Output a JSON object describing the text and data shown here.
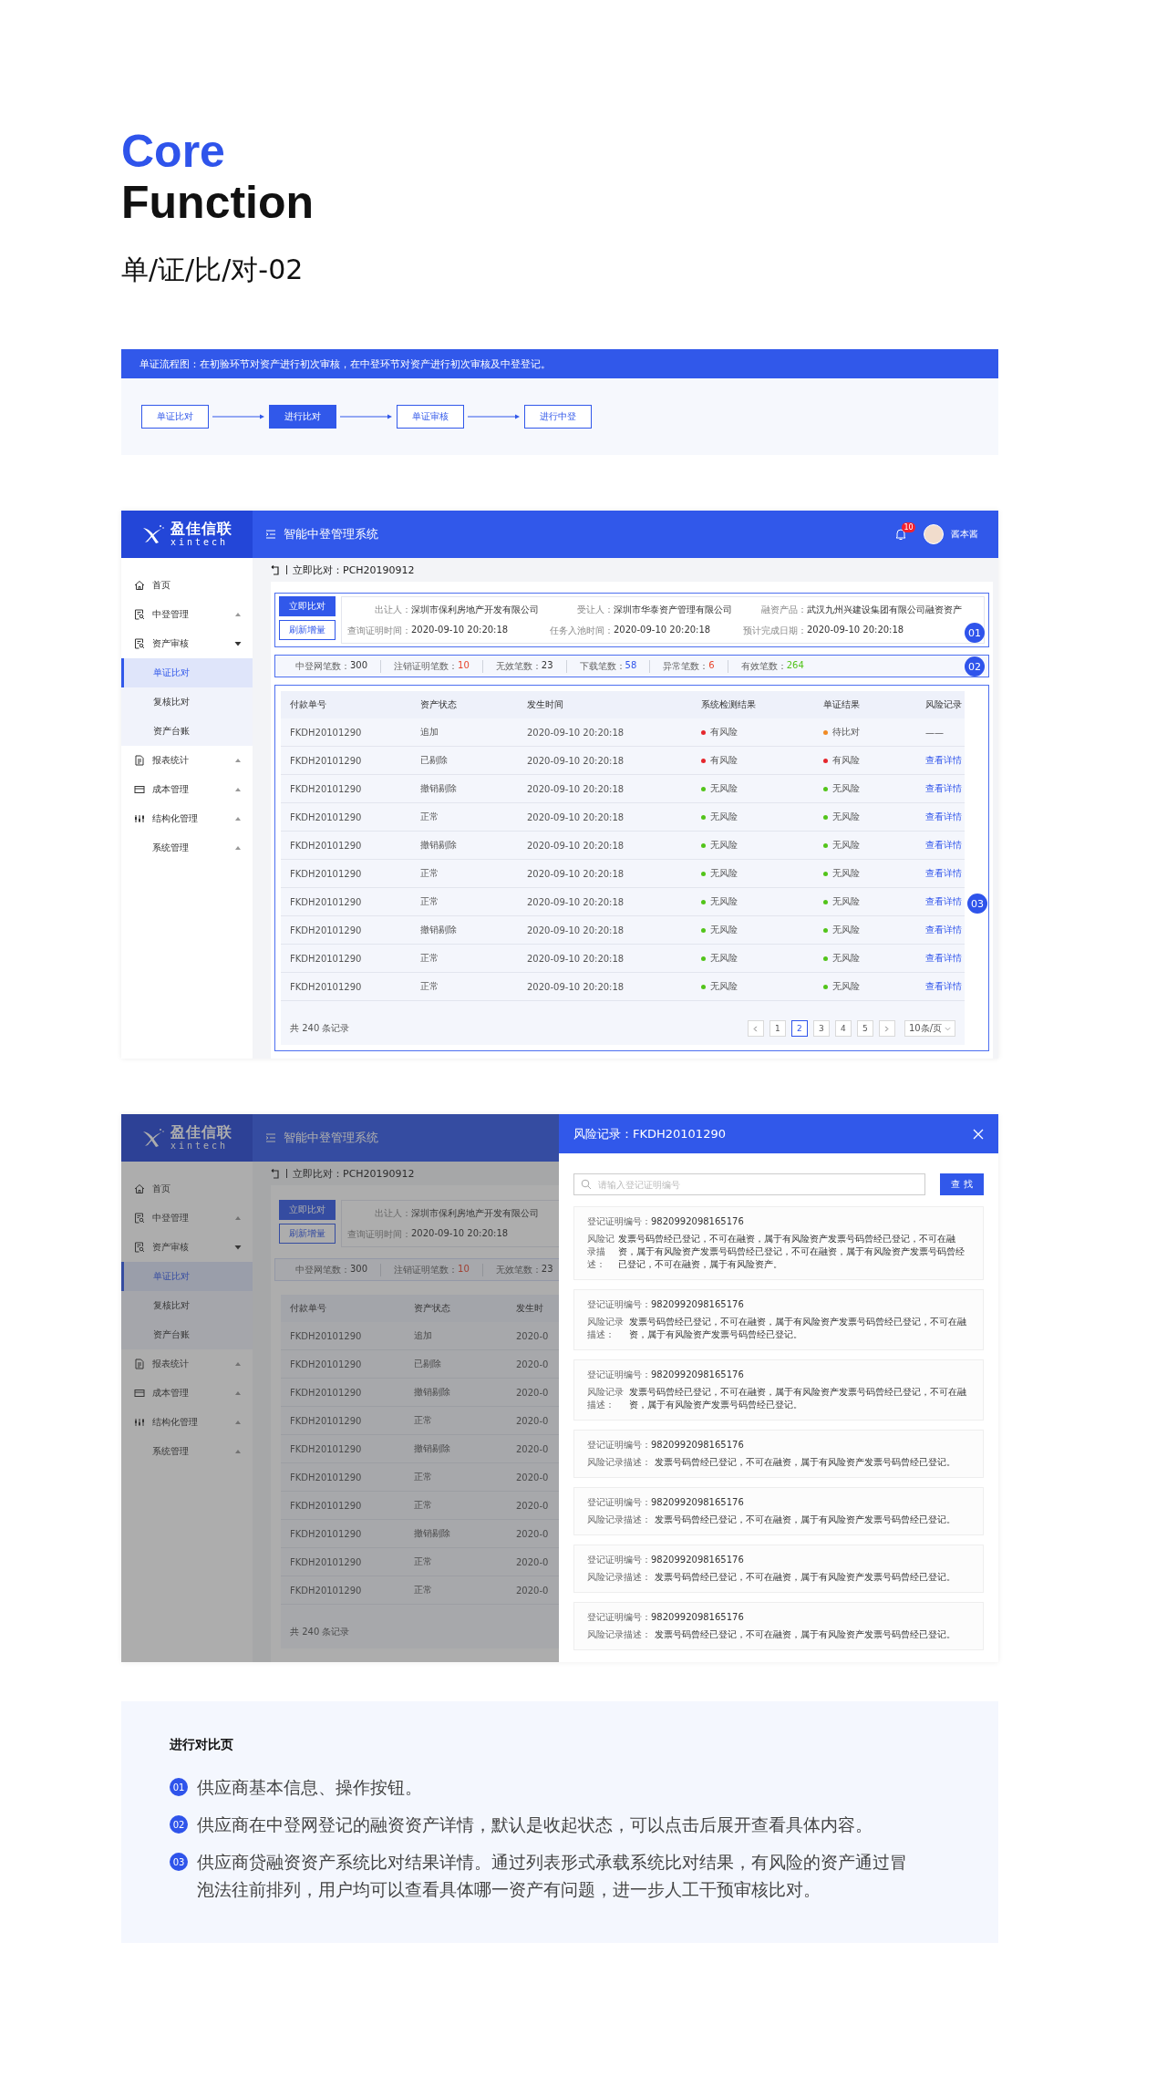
{
  "heading": {
    "accent": "Core",
    "title": "Function",
    "subtitle": "单/证/比/对-02"
  },
  "flow": {
    "caption": "单证流程图：在初验环节对资产进行初次审核，在中登环节对资产进行初次审核及中登登记。",
    "steps": [
      {
        "label": "单证比对",
        "selected": false
      },
      {
        "label": "进行比对",
        "selected": true
      },
      {
        "label": "单证审核",
        "selected": false
      },
      {
        "label": "进行中登",
        "selected": false
      }
    ]
  },
  "screens": [
    {
      "dimmed": false,
      "app": {
        "logo": {
          "name": "盈佳信联",
          "latin": "xintech"
        },
        "title": "智能中登管理系统",
        "notification_badge": "10",
        "user": "酱本酱",
        "menu": [
          {
            "label": "首页",
            "kind": "home"
          },
          {
            "label": "中登管理",
            "kind": "register",
            "expanded": false
          },
          {
            "label": "资产审核",
            "kind": "audit",
            "expanded": true,
            "children": [
              {
                "label": "单证比对",
                "selected": true
              },
              {
                "label": "复核比对",
                "selected": false
              },
              {
                "label": "资产台账",
                "selected": false
              }
            ]
          },
          {
            "label": "报表统计",
            "kind": "report",
            "expanded": false
          },
          {
            "label": "成本管理",
            "kind": "card",
            "expanded": false
          },
          {
            "label": "结构化管理",
            "kind": "structure",
            "expanded": false
          },
          {
            "label": "系统管理",
            "expanded": false
          }
        ],
        "breadcrumb": "立即比对：PCH20190912",
        "actions": [
          {
            "label": "立即比对",
            "kind": "primary"
          },
          {
            "label": "刷新增量",
            "kind": "secondary"
          }
        ],
        "info": [
          [
            {
              "label": "出让人：",
              "value": "深圳市保利房地产开发有限公司"
            },
            {
              "label": "查询证明时间：",
              "value": "2020-09-10 20:20:18"
            }
          ],
          [
            {
              "label": "受让人：",
              "value": "深圳市华泰资产管理有限公司"
            },
            {
              "label": "任务入池时间：",
              "value": "2020-09-10 20:20:18"
            }
          ],
          [
            {
              "label": "融资产品：",
              "value": "武汉九州兴建设集团有限公司融资资产"
            },
            {
              "label": "预计完成日期：",
              "value": "2020-09-10 20:20:18"
            }
          ]
        ],
        "stats": [
          {
            "label": "中登网笔数：",
            "value": "300",
            "color": "#333333"
          },
          {
            "label": "注销证明笔数：",
            "value": "10",
            "color": "#e8452c"
          },
          {
            "label": "无效笔数：",
            "value": "23",
            "color": "#333333"
          },
          {
            "label": "下载笔数：",
            "value": "58",
            "color": "#2f54eb"
          },
          {
            "label": "异常笔数：",
            "value": "6",
            "color": "#e8452c"
          },
          {
            "label": "有效笔数：",
            "value": "264",
            "color": "#52c41a"
          }
        ],
        "table": {
          "columns": [
            "付款单号",
            "资产状态",
            "发生时间",
            "系统检测结果",
            "单证结果",
            "风险记录"
          ],
          "rows": [
            {
              "cells": [
                "FKDH20101290",
                "追加",
                "2020-09-10 20:20:18"
              ],
              "check": {
                "text": "有风险",
                "color": "#e5272d"
              },
              "result": {
                "text": "待比对",
                "color": "#f08a24"
              },
              "risk": {
                "kind": "text",
                "text": "——"
              }
            },
            {
              "cells": [
                "FKDH20101290",
                "已剔除",
                "2020-09-10 20:20:18"
              ],
              "check": {
                "text": "有风险",
                "color": "#e5272d"
              },
              "result": {
                "text": "有风险",
                "color": "#e5272d"
              },
              "risk": {
                "kind": "link",
                "text": "查看详情"
              }
            },
            {
              "cells": [
                "FKDH20101290",
                "撤销剔除",
                "2020-09-10 20:20:18"
              ],
              "check": {
                "text": "无风险",
                "color": "#52c41a"
              },
              "result": {
                "text": "无风险",
                "color": "#52c41a"
              },
              "risk": {
                "kind": "link",
                "text": "查看详情"
              }
            },
            {
              "cells": [
                "FKDH20101290",
                "正常",
                "2020-09-10 20:20:18"
              ],
              "check": {
                "text": "无风险",
                "color": "#52c41a"
              },
              "result": {
                "text": "无风险",
                "color": "#52c41a"
              },
              "risk": {
                "kind": "link",
                "text": "查看详情"
              }
            },
            {
              "cells": [
                "FKDH20101290",
                "撤销剔除",
                "2020-09-10 20:20:18"
              ],
              "check": {
                "text": "无风险",
                "color": "#52c41a"
              },
              "result": {
                "text": "无风险",
                "color": "#52c41a"
              },
              "risk": {
                "kind": "link",
                "text": "查看详情"
              }
            },
            {
              "cells": [
                "FKDH20101290",
                "正常",
                "2020-09-10 20:20:18"
              ],
              "check": {
                "text": "无风险",
                "color": "#52c41a"
              },
              "result": {
                "text": "无风险",
                "color": "#52c41a"
              },
              "risk": {
                "kind": "link",
                "text": "查看详情"
              }
            },
            {
              "cells": [
                "FKDH20101290",
                "正常",
                "2020-09-10 20:20:18"
              ],
              "check": {
                "text": "无风险",
                "color": "#52c41a"
              },
              "result": {
                "text": "无风险",
                "color": "#52c41a"
              },
              "risk": {
                "kind": "link",
                "text": "查看详情"
              }
            },
            {
              "cells": [
                "FKDH20101290",
                "撤销剔除",
                "2020-09-10 20:20:18"
              ],
              "check": {
                "text": "无风险",
                "color": "#52c41a"
              },
              "result": {
                "text": "无风险",
                "color": "#52c41a"
              },
              "risk": {
                "kind": "link",
                "text": "查看详情"
              }
            },
            {
              "cells": [
                "FKDH20101290",
                "正常",
                "2020-09-10 20:20:18"
              ],
              "check": {
                "text": "无风险",
                "color": "#52c41a"
              },
              "result": {
                "text": "无风险",
                "color": "#52c41a"
              },
              "risk": {
                "kind": "link",
                "text": "查看详情"
              }
            },
            {
              "cells": [
                "FKDH20101290",
                "正常",
                "2020-09-10 20:20:18"
              ],
              "check": {
                "text": "无风险",
                "color": "#52c41a"
              },
              "result": {
                "text": "无风险",
                "color": "#52c41a"
              },
              "risk": {
                "kind": "link",
                "text": "查看详情"
              }
            }
          ],
          "total": "共 240 条记录",
          "pages": [
            {
              "label": "1",
              "selected": false
            },
            {
              "label": "2",
              "selected": true
            },
            {
              "label": "3",
              "selected": false
            },
            {
              "label": "4",
              "selected": false
            },
            {
              "label": "5",
              "selected": false
            }
          ],
          "page_size": "10条/页"
        },
        "annotations": [
          "01",
          "02",
          "03"
        ]
      }
    },
    {
      "dimmed": true,
      "app": {
        "logo": {
          "name": "盈佳信联",
          "latin": "xintech"
        },
        "title": "智能中登管理系统",
        "menu": [
          {
            "label": "首页",
            "kind": "home"
          },
          {
            "label": "中登管理",
            "kind": "register",
            "expanded": false
          },
          {
            "label": "资产审核",
            "kind": "audit",
            "expanded": true,
            "children": [
              {
                "label": "单证比对",
                "selected": true
              },
              {
                "label": "复核比对",
                "selected": false
              },
              {
                "label": "资产台账",
                "selected": false
              }
            ]
          },
          {
            "label": "报表统计",
            "kind": "report",
            "expanded": false
          },
          {
            "label": "成本管理",
            "kind": "card",
            "expanded": false
          },
          {
            "label": "结构化管理",
            "kind": "structure",
            "expanded": false
          },
          {
            "label": "系统管理",
            "expanded": false
          }
        ],
        "breadcrumb": "立即比对：PCH20190912",
        "actions": [
          {
            "label": "立即比对",
            "kind": "primary"
          },
          {
            "label": "刷新增量",
            "kind": "secondary"
          }
        ],
        "info": [
          [
            {
              "label": "出让人：",
              "value": "深圳市保利房地产开发有限公司"
            },
            {
              "label": "查询证明时间：",
              "value": "2020-09-10 20:20:18"
            }
          ]
        ],
        "stats": [
          {
            "label": "中登网笔数：",
            "value": "300",
            "color": "#373737"
          },
          {
            "label": "注销证明笔数：",
            "value": "10",
            "color": "#a04133"
          },
          {
            "label": "无效笔数：",
            "value": "23",
            "color": "#373737"
          }
        ],
        "table": {
          "columns": [
            "付款单号",
            "资产状态",
            "发生时"
          ],
          "rows": [
            {
              "cells": [
                "FKDH20101290",
                "追加",
                "2020-0"
              ]
            },
            {
              "cells": [
                "FKDH20101290",
                "已剔除",
                "2020-0"
              ]
            },
            {
              "cells": [
                "FKDH20101290",
                "撤销剔除",
                "2020-0"
              ]
            },
            {
              "cells": [
                "FKDH20101290",
                "正常",
                "2020-0"
              ]
            },
            {
              "cells": [
                "FKDH20101290",
                "撤销剔除",
                "2020-0"
              ]
            },
            {
              "cells": [
                "FKDH20101290",
                "正常",
                "2020-0"
              ]
            },
            {
              "cells": [
                "FKDH20101290",
                "正常",
                "2020-0"
              ]
            },
            {
              "cells": [
                "FKDH20101290",
                "撤销剔除",
                "2020-0"
              ]
            },
            {
              "cells": [
                "FKDH20101290",
                "正常",
                "2020-0"
              ]
            },
            {
              "cells": [
                "FKDH20101290",
                "正常",
                "2020-0"
              ]
            }
          ],
          "total": "共 240 条记录"
        }
      },
      "drawer": {
        "title": "风险记录：FKDH20101290",
        "search": {
          "placeholder": "请输入登记证明编号"
        },
        "search_button": "查 找",
        "records": [
          {
            "kind": "narrow",
            "label": "登记证明编号：",
            "number": "9820992098165176",
            "desc_label": "风险记录描述：",
            "desc": "发票号码曾经已登记，不可在融资，属于有风险资产发票号码曾经已登记，不可在融资，属于有风险资产发票号码曾经已登记，不可在融资，属于有风险资产发票号码曾经已登记，不可在融资，属于有风险资产。"
          },
          {
            "kind": "wide",
            "label": "登记证明编号：",
            "number": "9820992098165176",
            "desc_label": "风险记录描述：",
            "desc": "发票号码曾经已登记，不可在融资，属于有风险资产发票号码曾经已登记，不可在融资，属于有风险资产发票号码曾经已登记。"
          },
          {
            "kind": "wide",
            "label": "登记证明编号：",
            "number": "9820992098165176",
            "desc_label": "风险记录描述：",
            "desc": "发票号码曾经已登记，不可在融资，属于有风险资产发票号码曾经已登记，不可在融资，属于有风险资产发票号码曾经已登记。"
          },
          {
            "kind": "inline",
            "label": "登记证明编号：",
            "number": "9820992098165176",
            "desc_label": "风险记录描述：",
            "desc": "发票号码曾经已登记，不可在融资，属于有风险资产发票号码曾经已登记。"
          },
          {
            "kind": "inline",
            "label": "登记证明编号：",
            "number": "9820992098165176",
            "desc_label": "风险记录描述：",
            "desc": "发票号码曾经已登记，不可在融资，属于有风险资产发票号码曾经已登记。"
          },
          {
            "kind": "inline",
            "label": "登记证明编号：",
            "number": "9820992098165176",
            "desc_label": "风险记录描述：",
            "desc": "发票号码曾经已登记，不可在融资，属于有风险资产发票号码曾经已登记。"
          },
          {
            "kind": "inline",
            "label": "登记证明编号：",
            "number": "9820992098165176",
            "desc_label": "风险记录描述：",
            "desc": "发票号码曾经已登记，不可在融资，属于有风险资产发票号码曾经已登记。"
          }
        ]
      }
    }
  ],
  "notes": {
    "title": "进行对比页",
    "items": [
      {
        "badge": "01",
        "text": "供应商基本信息、操作按钮。"
      },
      {
        "badge": "02",
        "text": "供应商在中登网登记的融资资产详情，默认是收起状态，可以点击后展开查看具体内容。"
      },
      {
        "badge": "03",
        "text": "供应商贷融资资产系统比对结果详情。通过列表形式承载系统比对结果，有风险的资产通过冒泡法往前排列，用户均可以查看具体哪一资产有问题，进一步人工干预审核比对。"
      }
    ]
  }
}
